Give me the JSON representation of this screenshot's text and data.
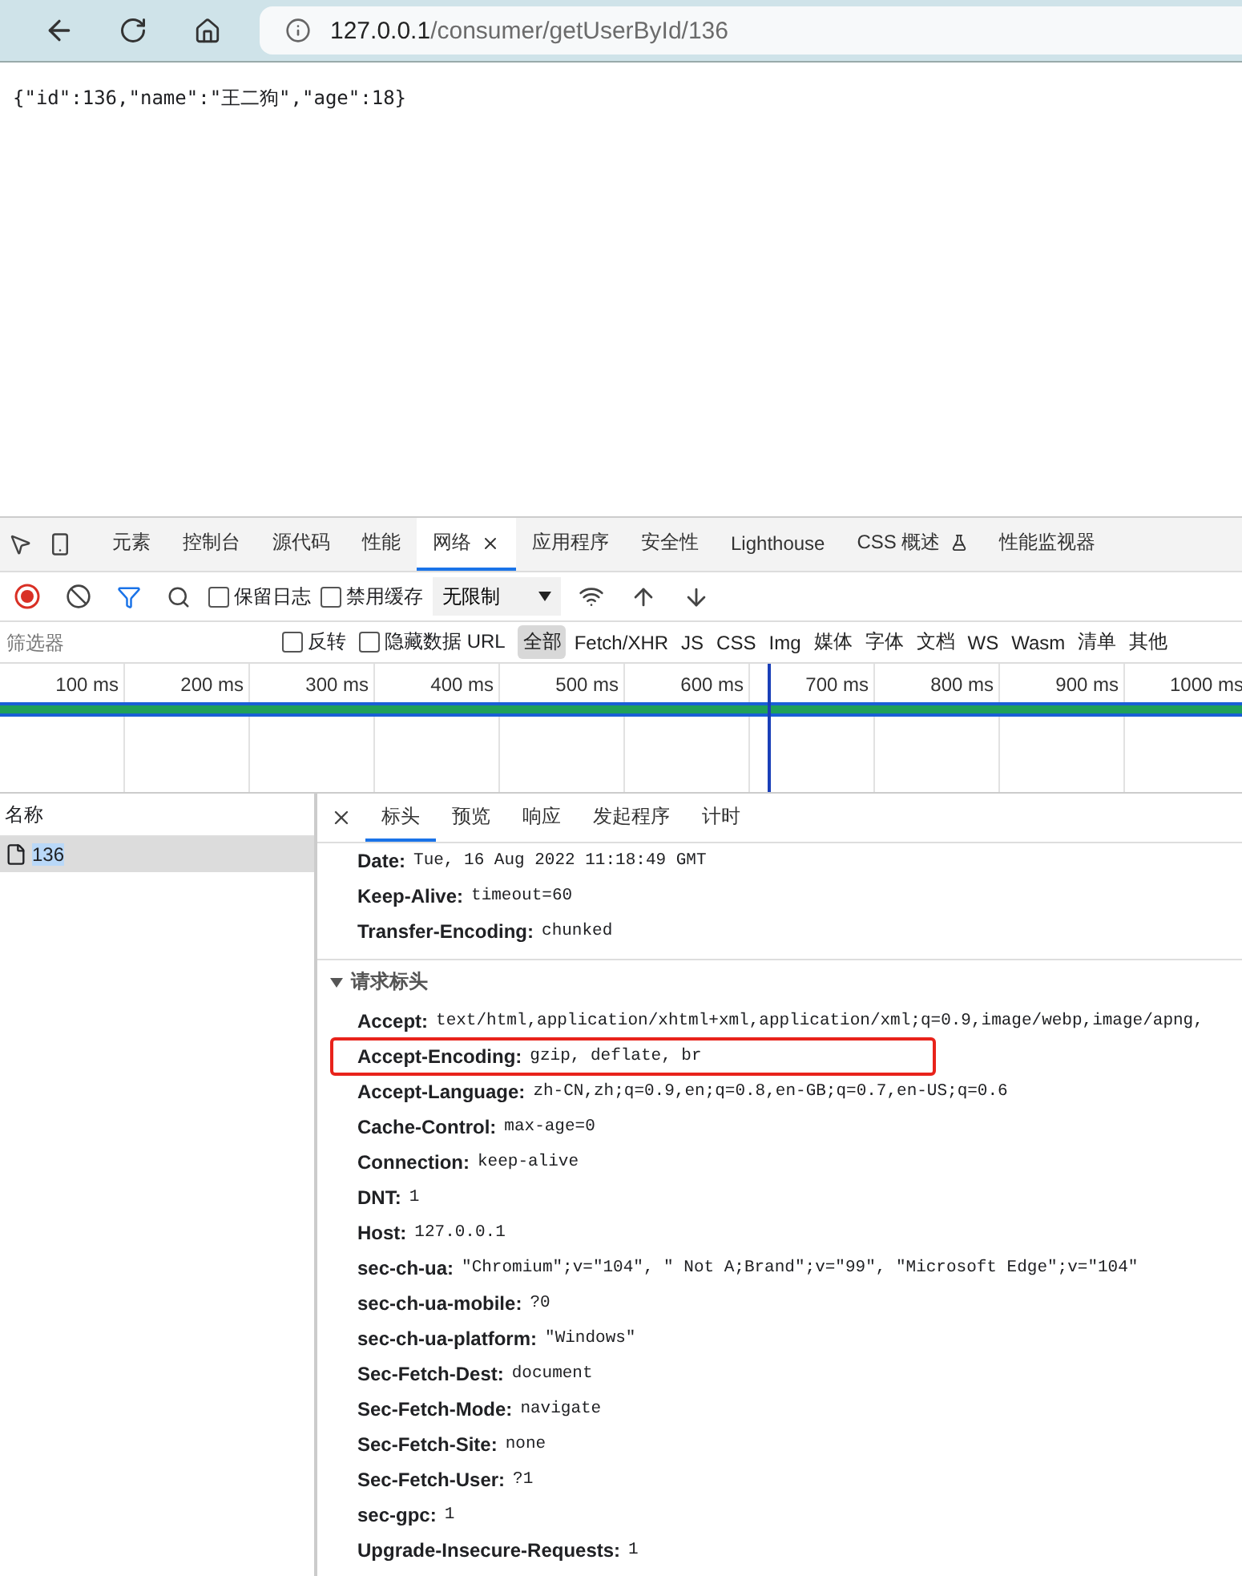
{
  "browser": {
    "url_host": "127.0.0.1",
    "url_path": "/consumer/getUserById/136"
  },
  "page": {
    "body_text": "{\"id\":136,\"name\":\"王二狗\",\"age\":18}"
  },
  "devtools": {
    "tabs": [
      {
        "label": "元素",
        "selected": false
      },
      {
        "label": "控制台",
        "selected": false
      },
      {
        "label": "源代码",
        "selected": false
      },
      {
        "label": "性能",
        "selected": false
      },
      {
        "label": "网络",
        "selected": true,
        "closable": true
      },
      {
        "label": "应用程序",
        "selected": false
      },
      {
        "label": "安全性",
        "selected": false
      },
      {
        "label": "Lighthouse",
        "selected": false
      },
      {
        "label": "CSS 概述",
        "selected": false,
        "experimental": true
      },
      {
        "label": "性能监视器",
        "selected": false
      }
    ],
    "toolbar": {
      "recording": true,
      "checkboxes": [
        {
          "label": "保留日志",
          "checked": false
        },
        {
          "label": "禁用缓存",
          "checked": false
        }
      ],
      "throttle": "无限制"
    },
    "filter": {
      "placeholder": "筛选器",
      "checkboxes": [
        {
          "label": "反转",
          "checked": false
        },
        {
          "label": "隐藏数据 URL",
          "checked": false
        }
      ],
      "types": [
        {
          "label": "全部",
          "selected": true
        },
        {
          "label": "Fetch/XHR",
          "selected": false
        },
        {
          "label": "JS",
          "selected": false
        },
        {
          "label": "CSS",
          "selected": false
        },
        {
          "label": "Img",
          "selected": false
        },
        {
          "label": "媒体",
          "selected": false
        },
        {
          "label": "字体",
          "selected": false
        },
        {
          "label": "文档",
          "selected": false
        },
        {
          "label": "WS",
          "selected": false
        },
        {
          "label": "Wasm",
          "selected": false
        },
        {
          "label": "清单",
          "selected": false
        },
        {
          "label": "其他",
          "selected": false
        }
      ]
    },
    "timeline": {
      "ticks": [
        "100 ms",
        "200 ms",
        "300 ms",
        "400 ms",
        "500 ms",
        "600 ms",
        "700 ms",
        "800 ms",
        "900 ms",
        "1000 ms"
      ]
    },
    "requests": {
      "header": "名称",
      "rows": [
        {
          "name": "136",
          "selected": true
        }
      ]
    },
    "detail_tabs": [
      {
        "label": "标头",
        "selected": true
      },
      {
        "label": "预览",
        "selected": false
      },
      {
        "label": "响应",
        "selected": false
      },
      {
        "label": "发起程序",
        "selected": false
      },
      {
        "label": "计时",
        "selected": false
      }
    ],
    "response_headers": [
      {
        "name": "Date:",
        "value": "Tue, 16 Aug 2022 11:18:49 GMT"
      },
      {
        "name": "Keep-Alive:",
        "value": "timeout=60"
      },
      {
        "name": "Transfer-Encoding:",
        "value": "chunked"
      }
    ],
    "request_section": {
      "title": "请求标头",
      "expanded": true,
      "headers": [
        {
          "name": "Accept:",
          "value": "text/html,application/xhtml+xml,application/xml;q=0.9,image/webp,image/apng,",
          "highlighted": false
        },
        {
          "name": "Accept-Encoding:",
          "value": "gzip, deflate, br",
          "highlighted": true
        },
        {
          "name": "Accept-Language:",
          "value": "zh-CN,zh;q=0.9,en;q=0.8,en-GB;q=0.7,en-US;q=0.6",
          "highlighted": false
        },
        {
          "name": "Cache-Control:",
          "value": "max-age=0",
          "highlighted": false
        },
        {
          "name": "Connection:",
          "value": "keep-alive",
          "highlighted": false
        },
        {
          "name": "DNT:",
          "value": "1",
          "highlighted": false
        },
        {
          "name": "Host:",
          "value": "127.0.0.1",
          "highlighted": false
        },
        {
          "name": "sec-ch-ua:",
          "value": "\"Chromium\";v=\"104\", \" Not A;Brand\";v=\"99\", \"Microsoft Edge\";v=\"104\"",
          "highlighted": false
        },
        {
          "name": "sec-ch-ua-mobile:",
          "value": "?0",
          "highlighted": false
        },
        {
          "name": "sec-ch-ua-platform:",
          "value": "\"Windows\"",
          "highlighted": false
        },
        {
          "name": "Sec-Fetch-Dest:",
          "value": "document",
          "highlighted": false
        },
        {
          "name": "Sec-Fetch-Mode:",
          "value": "navigate",
          "highlighted": false
        },
        {
          "name": "Sec-Fetch-Site:",
          "value": "none",
          "highlighted": false
        },
        {
          "name": "Sec-Fetch-User:",
          "value": "?1",
          "highlighted": false
        },
        {
          "name": "sec-gpc:",
          "value": "1",
          "highlighted": false
        },
        {
          "name": "Upgrade-Insecure-Requests:",
          "value": "1",
          "highlighted": false
        }
      ]
    }
  }
}
